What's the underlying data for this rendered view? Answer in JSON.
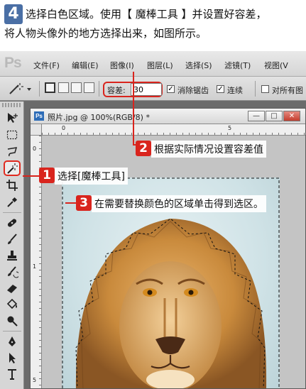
{
  "header": {
    "step_number": "4",
    "line1": "选择白色区域。使用【 魔棒工具 】并设置好容差，",
    "line2": "将人物头像外的地方选择出来，如图所示。"
  },
  "app": {
    "logo": "Ps",
    "menu": [
      "文件(F)",
      "编辑(E)",
      "图像(I)",
      "图层(L)",
      "选择(S)",
      "滤镜(T)",
      "视图(V"
    ]
  },
  "options": {
    "tolerance_label": "容差:",
    "tolerance_value": "30",
    "anti_alias_label": "消除锯齿",
    "contiguous_label": "连续",
    "sample_all_label": "对所有图",
    "check_mark": "✓"
  },
  "document": {
    "title": "照片.jpg @ 100%(RGB/8) *",
    "ps_icon": "Ps",
    "minimize": "—",
    "maximize": "□",
    "close": "✕",
    "ruler_top": [
      "0",
      "5"
    ],
    "ruler_left": [
      "0",
      "1",
      "5"
    ]
  },
  "callouts": [
    {
      "num": "1",
      "text": "选择[魔棒工具]"
    },
    {
      "num": "2",
      "text": "根据实际情况设置容差值"
    },
    {
      "num": "3",
      "text": "在需要替换颜色的区域单击得到选区。"
    }
  ],
  "colors": {
    "accent_red": "#d9241d",
    "step_blue": "#4a6fa5",
    "lion_mane": "#c98a3c",
    "background": "#d6e6ea"
  },
  "icons": [
    "move-icon",
    "marquee-icon",
    "lasso-icon",
    "magic-wand-icon",
    "crop-icon",
    "eyedropper-icon",
    "healing-brush-icon",
    "brush-icon",
    "stamp-icon",
    "history-brush-icon",
    "eraser-icon",
    "paint-bucket-icon",
    "dodge-icon",
    "pen-icon",
    "path-selection-icon",
    "type-icon"
  ]
}
